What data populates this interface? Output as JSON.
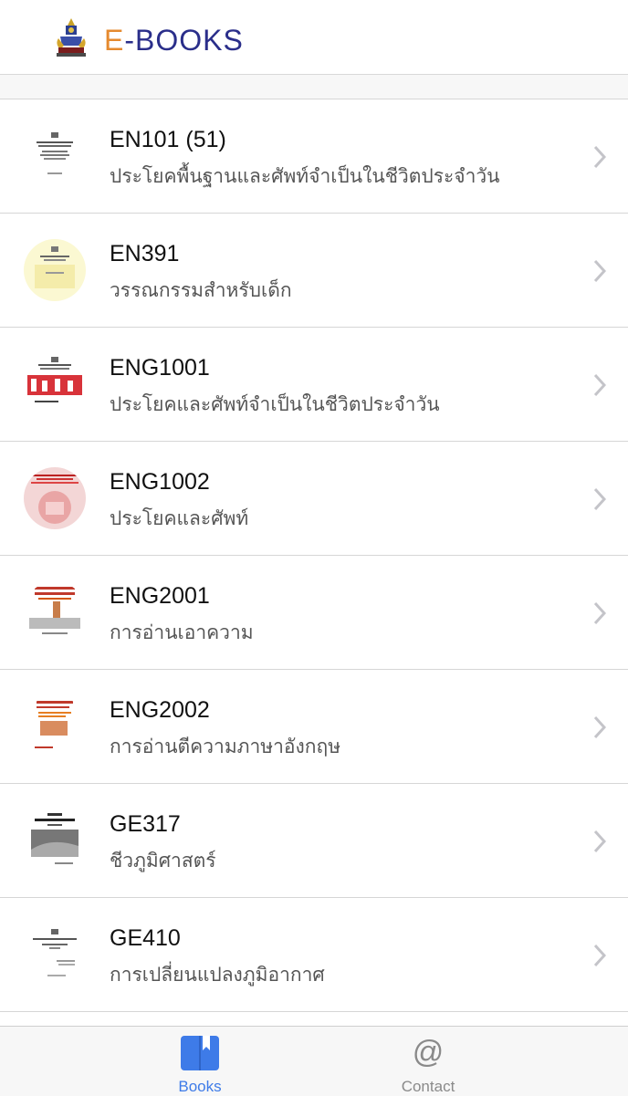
{
  "header": {
    "brand_first": "E",
    "brand_rest": "-BOOKS"
  },
  "books": [
    {
      "code": "EN101 (51)",
      "title": "ประโยคพื้นฐานและศัพท์จำเป็นในชีวิตประจำวัน",
      "thumb": "cover-en101-thumbnail"
    },
    {
      "code": "EN391",
      "title": "วรรณกรรมสำหรับเด็ก",
      "thumb": "cover-en391-thumbnail"
    },
    {
      "code": "ENG1001",
      "title": "ประโยคและศัพท์จำเป็นในชีวิตประจำวัน",
      "thumb": "cover-eng1001-thumbnail"
    },
    {
      "code": "ENG1002",
      "title": "ประโยคและศัพท์",
      "thumb": "cover-eng1002-thumbnail"
    },
    {
      "code": "ENG2001",
      "title": "การอ่านเอาความ",
      "thumb": "cover-eng2001-thumbnail"
    },
    {
      "code": "ENG2002",
      "title": "การอ่านตีความภาษาอังกฤษ",
      "thumb": "cover-eng2002-thumbnail"
    },
    {
      "code": "GE317",
      "title": "ชีวภูมิศาสตร์",
      "thumb": "cover-ge317-thumbnail"
    },
    {
      "code": "GE410",
      "title": "การเปลี่ยนแปลงภูมิอากาศ",
      "thumb": "cover-ge410-thumbnail"
    }
  ],
  "tabbar": {
    "books_label": "Books",
    "contact_label": "Contact",
    "contact_glyph": "@",
    "active_color": "#3e7be8",
    "inactive_color": "#8a8a8a"
  },
  "colors": {
    "brand_orange": "#e58a2f",
    "brand_navy": "#2a2e8a"
  }
}
